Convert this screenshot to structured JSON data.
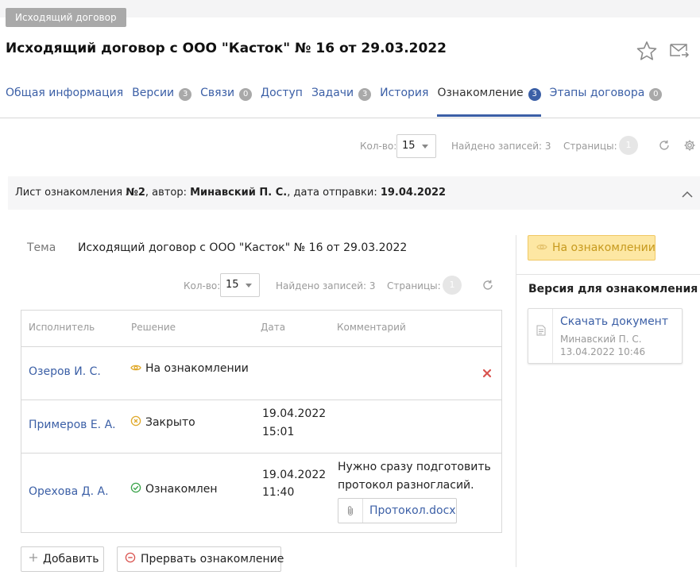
{
  "header": {
    "tag": "Исходящий договор",
    "title": "Исходящий договор с ООО \"Касток\" № 16 от 29.03.2022"
  },
  "tabs": [
    {
      "label": "Общая информация",
      "badge": null
    },
    {
      "label": "Версии",
      "badge": "3"
    },
    {
      "label": "Связи",
      "badge": "0"
    },
    {
      "label": "Доступ",
      "badge": null
    },
    {
      "label": "Задачи",
      "badge": "3"
    },
    {
      "label": "История",
      "badge": null
    },
    {
      "label": "Ознакомление",
      "badge": "3",
      "active": true
    },
    {
      "label": "Этапы договора",
      "badge": "0"
    }
  ],
  "pager_top": {
    "count_label": "Кол-во:",
    "count_value": "15",
    "found": "Найдено записей: 3",
    "pages_label": "Страницы:",
    "page": "1"
  },
  "sheet": {
    "prefix": "Лист ознакомления ",
    "number": "№2",
    "author_label": ", автор: ",
    "author": "Минавский П. С.",
    "date_label": ", дата отправки: ",
    "date": "19.04.2022",
    "topic_label": "Тема",
    "topic": "Исходящий договор с ООО \"Касток\" № 16 от 29.03.2022"
  },
  "pager_inner": {
    "count_label": "Кол-во:",
    "count_value": "15",
    "found": "Найдено записей: 3",
    "pages_label": "Страницы:",
    "page": "1"
  },
  "table": {
    "headers": [
      "Исполнитель",
      "Решение",
      "Дата",
      "Комментарий"
    ],
    "rows": [
      {
        "person": "Озеров И. С.",
        "decision": "На ознакомлении",
        "date": "",
        "time": "",
        "comment1": "",
        "comment2": ""
      },
      {
        "person": "Примеров Е. А.",
        "decision": "Закрыто",
        "date": "19.04.2022",
        "time": "15:01",
        "comment1": "",
        "comment2": ""
      },
      {
        "person": "Орехова Д. А.",
        "decision": "Ознакомлен",
        "date": "19.04.2022",
        "time": "11:40",
        "comment1": "Нужно сразу подготовить",
        "comment2": "протокол разногласий.",
        "attachment": "Протокол.docx"
      }
    ]
  },
  "buttons": {
    "add": "Добавить",
    "abort": "Прервать ознакомление"
  },
  "side": {
    "status": "На ознакомлении",
    "version_title": "Версия для ознакомления",
    "doc_link": "Скачать документ",
    "doc_author": "Минавский П. С.",
    "doc_date": "13.04.2022 10:46"
  },
  "colors": {
    "accent": "#3b5fa6",
    "status_bg": "#fde7a3",
    "status_text": "#c79a1e",
    "danger": "#d9534f",
    "success": "#3aa34a"
  }
}
